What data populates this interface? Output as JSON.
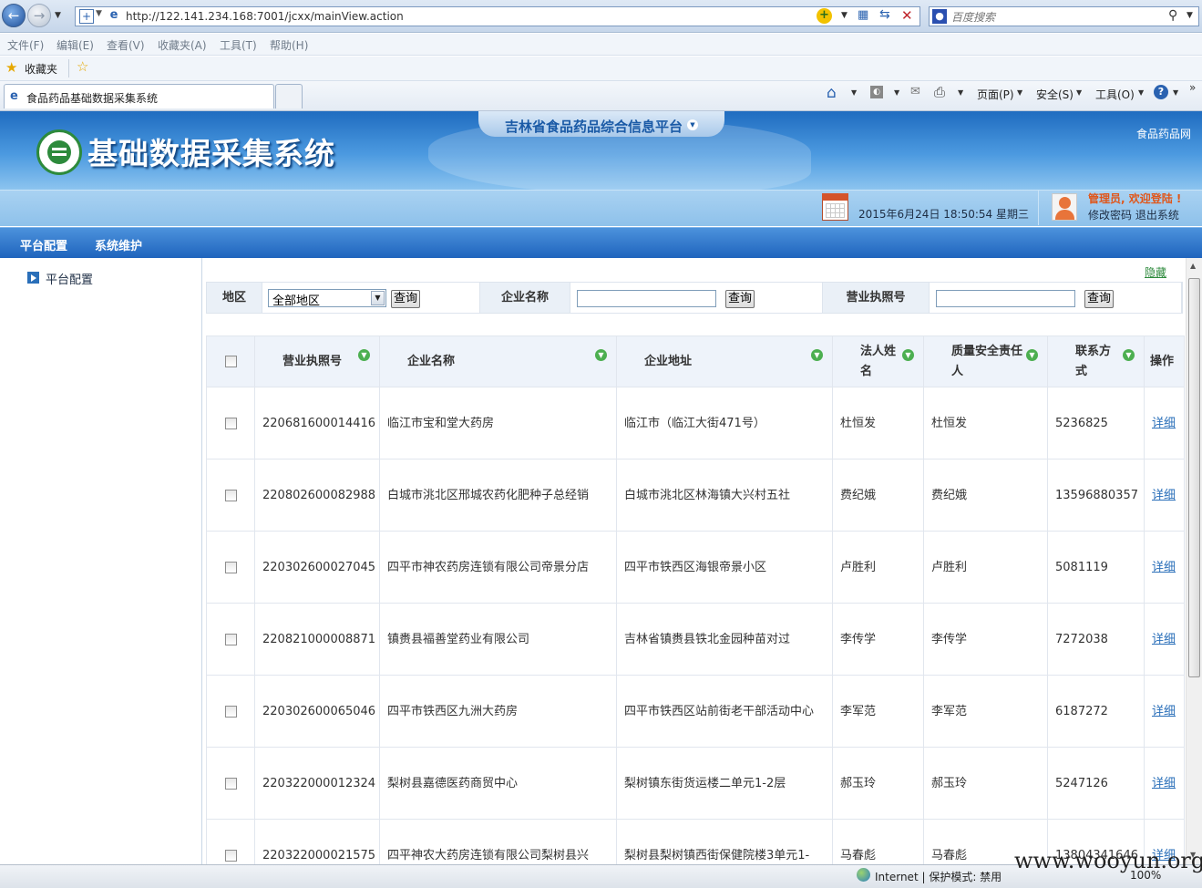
{
  "browser": {
    "url": "http://122.141.234.168:7001/jcxx/mainView.action",
    "search_placeholder": "百度搜索",
    "menu": [
      "文件(F)",
      "编辑(E)",
      "查看(V)",
      "收藏夹(A)",
      "工具(T)",
      "帮助(H)"
    ],
    "favorites_label": "收藏夹",
    "tab_title": "食品药品基础数据采集系统",
    "commands": [
      "页面(P)",
      "安全(S)",
      "工具(O)"
    ],
    "status": "Internet | 保护模式: 禁用",
    "zoom": "100%"
  },
  "header": {
    "platform_title": "吉林省食品药品综合信息平台",
    "system_name": "基础数据采集系统",
    "site_link": "食品药品网",
    "datetime": "2015年6月24日 18:50:54 星期三",
    "welcome": "管理员, 欢迎登陆 !",
    "change_password": "修改密码",
    "logout": "退出系统"
  },
  "nav": {
    "items": [
      "平台配置",
      "系统维护"
    ]
  },
  "sidebar": {
    "item": "平台配置"
  },
  "content": {
    "hide_link": "隐藏",
    "filter": {
      "region_label": "地区",
      "region_value": "全部地区",
      "company_label": "企业名称",
      "license_label": "营业执照号",
      "query_label": "查询"
    },
    "columns": [
      "营业执照号",
      "企业名称",
      "企业地址",
      "法人姓名",
      "质量安全责任人",
      "联系方式",
      "操作"
    ],
    "detail_label": "详细",
    "rows": [
      {
        "license": "220681600014416",
        "name": "临江市宝和堂大药房",
        "address": "临江市（临江大街471号）",
        "legal": "杜恒发",
        "safety": "杜恒发",
        "contact": "5236825"
      },
      {
        "license": "220802600082988",
        "name": "白城市洮北区邢城农药化肥种子总经销",
        "address": "白城市洮北区林海镇大兴村五社",
        "legal": "费纪娥",
        "safety": "费纪娥",
        "contact": "13596880357"
      },
      {
        "license": "220302600027045",
        "name": "四平市神农药房连锁有限公司帝景分店",
        "address": "四平市铁西区海银帝景小区",
        "legal": "卢胜利",
        "safety": "卢胜利",
        "contact": "5081119"
      },
      {
        "license": "220821000008871",
        "name": "镇赉县福善堂药业有限公司",
        "address": "吉林省镇赉县铁北金园种苗对过",
        "legal": "李传学",
        "safety": "李传学",
        "contact": "7272038"
      },
      {
        "license": "220302600065046",
        "name": "四平市铁西区九洲大药房",
        "address": "四平市铁西区站前街老干部活动中心",
        "legal": "李军范",
        "safety": "李军范",
        "contact": "6187272"
      },
      {
        "license": "220322000012324",
        "name": "梨树县嘉德医药商贸中心",
        "address": "梨树镇东街货运楼二单元1-2层",
        "legal": "郝玉玲",
        "safety": "郝玉玲",
        "contact": "5247126"
      },
      {
        "license": "220322000021575",
        "name": "四平神农大药房连锁有限公司梨树县兴",
        "address": "梨树县梨树镇西街保健院楼3单元1-",
        "legal": "马春彪",
        "safety": "马春彪",
        "contact": "13804341646"
      }
    ]
  },
  "watermark": "www.wooyun.org"
}
